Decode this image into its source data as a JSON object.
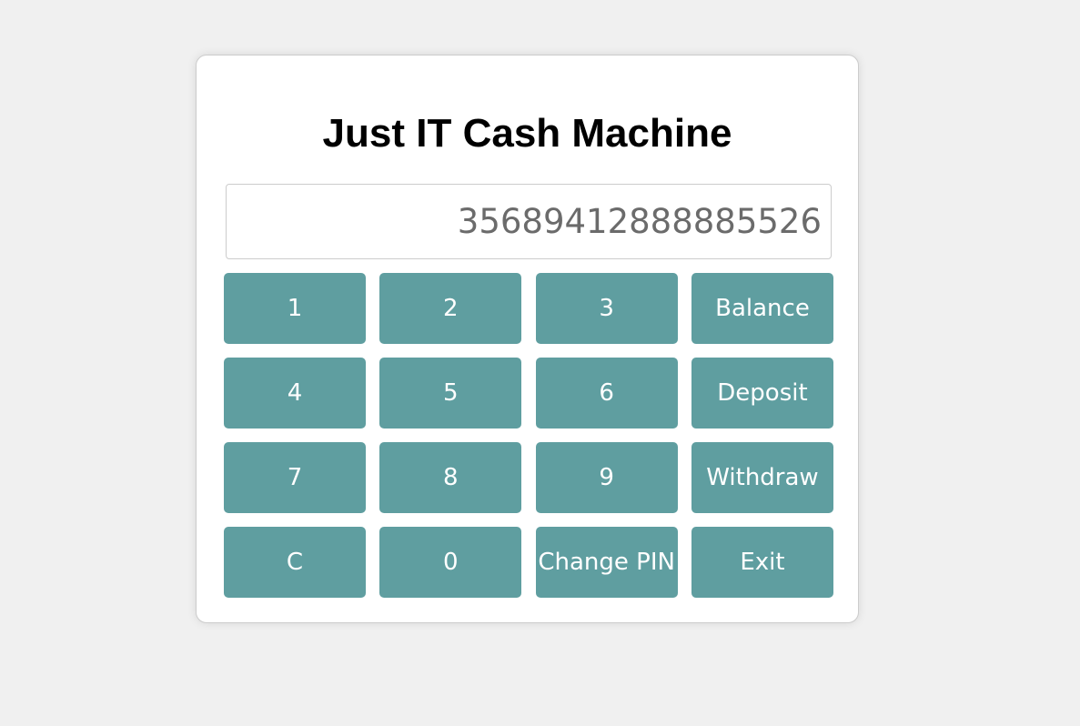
{
  "app": {
    "title": "Just IT Cash Machine"
  },
  "display": {
    "value": "35689412888885526"
  },
  "keypad": {
    "keys": [
      {
        "label": "1"
      },
      {
        "label": "2"
      },
      {
        "label": "3"
      },
      {
        "label": "Balance"
      },
      {
        "label": "4"
      },
      {
        "label": "5"
      },
      {
        "label": "6"
      },
      {
        "label": "Deposit"
      },
      {
        "label": "7"
      },
      {
        "label": "8"
      },
      {
        "label": "9"
      },
      {
        "label": "Withdraw"
      },
      {
        "label": "C"
      },
      {
        "label": "0"
      },
      {
        "label": "Change PIN"
      },
      {
        "label": "Exit"
      }
    ]
  },
  "colors": {
    "page_background": "#f0f0f0",
    "card_background": "#ffffff",
    "button_background": "#5f9ea0",
    "button_text": "#ffffff",
    "display_text": "#6b6b6b"
  }
}
